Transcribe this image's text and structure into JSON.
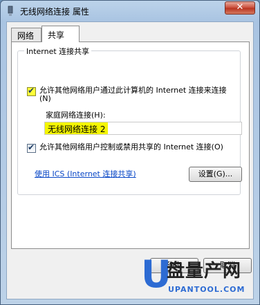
{
  "window": {
    "title": "无线网络连接 属性",
    "close_label": "✕"
  },
  "tabs": [
    {
      "label": "网络"
    },
    {
      "label": "共享"
    }
  ],
  "sharing": {
    "group_title": "Internet 连接共享",
    "allow_connect": {
      "label": "允许其他网络用户通过此计算机的 Internet 连接来连接(N)",
      "checked": true
    },
    "home_network_label": "家庭网络连接(H):",
    "home_network_value": "无线网络连接 2",
    "allow_control": {
      "label": "允许其他网络用户控制或禁用共享的 Internet 连接(O)",
      "checked": true
    },
    "ics_link": "使用 ICS (Internet 连接共享)",
    "settings_button": "设置(G)..."
  },
  "buttons": {
    "ok": "确定",
    "cancel": "取消"
  },
  "watermark": {
    "letter": "U",
    "text": "盘量产网",
    "sub": "UPANTOOL.COM"
  },
  "colors": {
    "highlight": "#f4f500",
    "link": "#0645c6"
  }
}
